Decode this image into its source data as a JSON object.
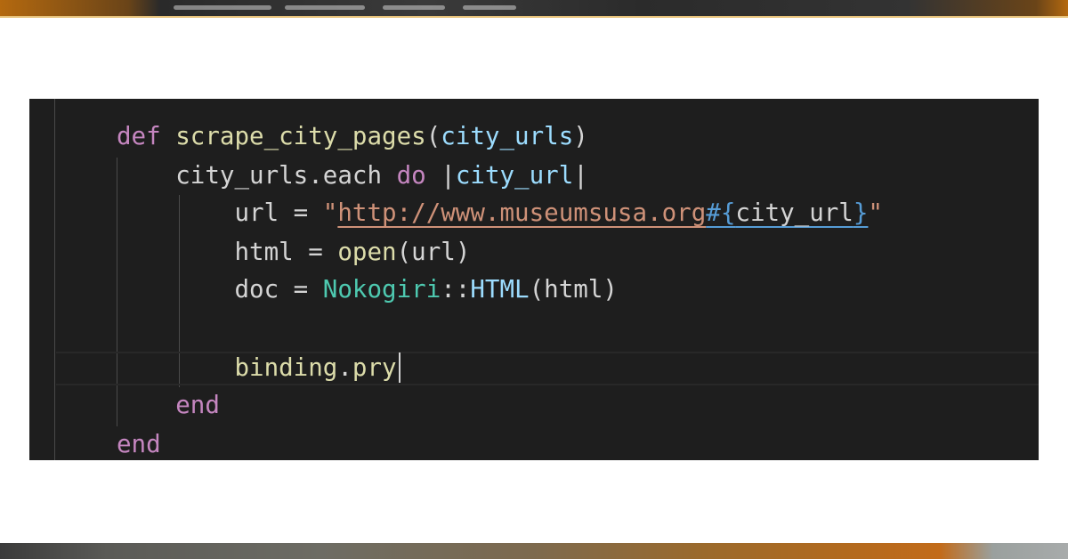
{
  "editor": {
    "theme_colors": {
      "background": "#1e1e1e",
      "keyword": "#c586c0",
      "function": "#dcdcaa",
      "parameter": "#9cdcfe",
      "string": "#ce9178",
      "class": "#4ec9b0",
      "interpolation": "#569cd6",
      "text": "#d4d4d4"
    },
    "lines": [
      {
        "tokens": [
          {
            "type": "kw",
            "text": "def"
          },
          {
            "type": "punc",
            "text": " "
          },
          {
            "type": "fn",
            "text": "scrape_city_pages"
          },
          {
            "type": "punc",
            "text": "("
          },
          {
            "type": "param",
            "text": "city_urls"
          },
          {
            "type": "punc",
            "text": ")"
          }
        ]
      },
      {
        "tokens": [
          {
            "type": "var",
            "text": "    city_urls.each "
          },
          {
            "type": "kw",
            "text": "do"
          },
          {
            "type": "punc",
            "text": " |"
          },
          {
            "type": "param",
            "text": "city_url"
          },
          {
            "type": "punc",
            "text": "|"
          }
        ]
      },
      {
        "tokens": [
          {
            "type": "var",
            "text": "        url = "
          },
          {
            "type": "str",
            "text": "\""
          },
          {
            "type": "str-url",
            "text": "http://www.museumsusa.org"
          },
          {
            "type": "interp",
            "text": "#{"
          },
          {
            "type": "interp-var",
            "text": "city_url"
          },
          {
            "type": "interp",
            "text": "}"
          },
          {
            "type": "str",
            "text": "\""
          }
        ]
      },
      {
        "tokens": [
          {
            "type": "var",
            "text": "        html = "
          },
          {
            "type": "fn",
            "text": "open"
          },
          {
            "type": "punc",
            "text": "(url)"
          }
        ]
      },
      {
        "tokens": [
          {
            "type": "var",
            "text": "        doc = "
          },
          {
            "type": "cls",
            "text": "Nokogiri"
          },
          {
            "type": "punc",
            "text": "::"
          },
          {
            "type": "const",
            "text": "HTML"
          },
          {
            "type": "punc",
            "text": "(html)"
          }
        ]
      },
      {
        "tokens": []
      },
      {
        "tokens": [
          {
            "type": "fn",
            "text": "        binding"
          },
          {
            "type": "punc",
            "text": "."
          },
          {
            "type": "fn",
            "text": "pry"
          }
        ]
      },
      {
        "tokens": [
          {
            "type": "kw",
            "text": "    end"
          }
        ]
      },
      {
        "tokens": [
          {
            "type": "kw",
            "text": "end"
          }
        ]
      }
    ]
  }
}
